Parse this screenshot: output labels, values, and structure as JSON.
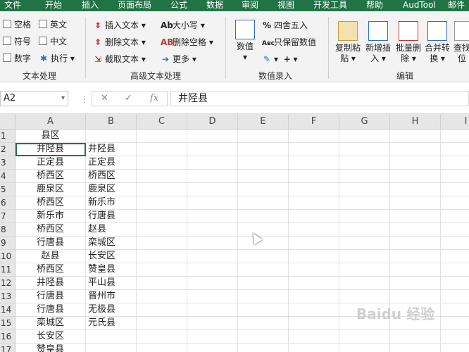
{
  "menu": [
    "文件",
    "开始",
    "插入",
    "页面布局",
    "公式",
    "数据",
    "审阅",
    "视图",
    "开发工具",
    "帮助",
    "AudTool",
    "邮件"
  ],
  "ribbon": {
    "text_processing": {
      "items": [
        "空格",
        "英文",
        "符号",
        "中文",
        "数字",
        "执行"
      ],
      "group": "文本处理"
    },
    "advanced_text": {
      "items": [
        "插入文本",
        "删除文本",
        "截取文本",
        "大小写",
        "删除空格",
        "更多"
      ],
      "group": "高级文本处理"
    },
    "numeric": {
      "big": "数值",
      "items": [
        "四舍五入",
        "只保留数值"
      ],
      "group": "数值录入"
    },
    "edit": {
      "buttons": [
        [
          "复制粘",
          "贴"
        ],
        [
          "新增插",
          "入"
        ],
        [
          "批量删",
          "除"
        ],
        [
          "合并转",
          "换"
        ],
        [
          "查找",
          "位"
        ]
      ],
      "group": "编辑"
    }
  },
  "formula_bar": {
    "name_box": "A2",
    "fx": "fx",
    "value": "井陉县"
  },
  "columns": [
    "A",
    "B",
    "C",
    "D",
    "E",
    "F",
    "G",
    "H",
    "I"
  ],
  "rows": [
    {
      "n": "1",
      "a": "县区",
      "b": ""
    },
    {
      "n": "2",
      "a": "井陉县",
      "b": "井陉县"
    },
    {
      "n": "3",
      "a": "正定县",
      "b": "正定县"
    },
    {
      "n": "4",
      "a": "桥西区",
      "b": "桥西区"
    },
    {
      "n": "5",
      "a": "鹿泉区",
      "b": "鹿泉区"
    },
    {
      "n": "6",
      "a": "桥西区",
      "b": "新乐市"
    },
    {
      "n": "7",
      "a": "新乐市",
      "b": "行唐县"
    },
    {
      "n": "8",
      "a": "桥西区",
      "b": "赵县"
    },
    {
      "n": "9",
      "a": "行唐县",
      "b": "栾城区"
    },
    {
      "n": "10",
      "a": "赵县",
      "b": "长安区"
    },
    {
      "n": "11",
      "a": "桥西区",
      "b": "赞皇县"
    },
    {
      "n": "12",
      "a": "井陉县",
      "b": "平山县"
    },
    {
      "n": "13",
      "a": "行唐县",
      "b": "晋州市"
    },
    {
      "n": "14",
      "a": "行唐县",
      "b": "无极县"
    },
    {
      "n": "15",
      "a": "栾城区",
      "b": "元氏县"
    },
    {
      "n": "16",
      "a": "长安区",
      "b": ""
    },
    {
      "n": "17",
      "a": "赞皇县",
      "b": ""
    }
  ],
  "watermark": "Baidu 经验"
}
